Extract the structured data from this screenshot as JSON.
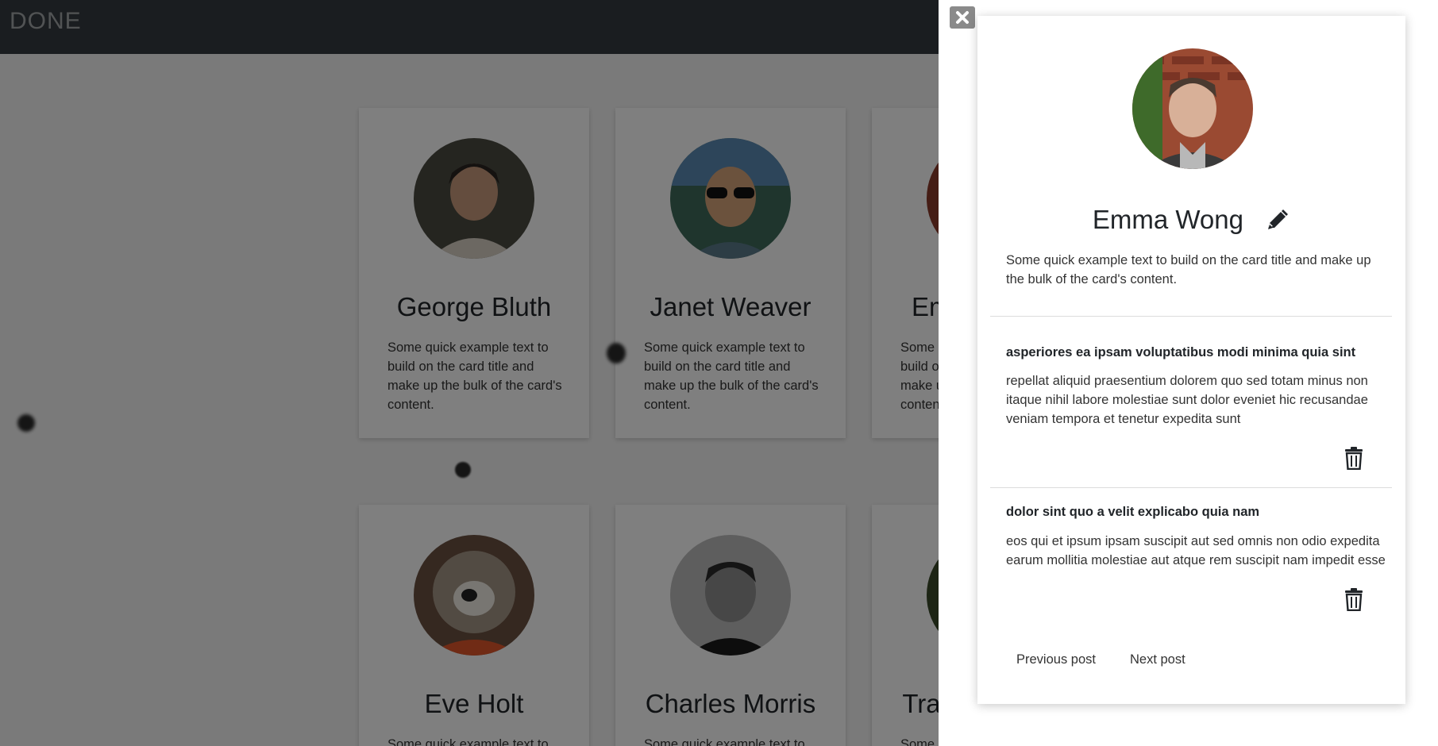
{
  "navbar": {
    "brand": "DONE"
  },
  "cards": [
    {
      "name": "George Bluth",
      "text": "Some quick example text to build on the card title and make up the bulk of the card's content."
    },
    {
      "name": "Janet Weaver",
      "text": "Some quick example text to build on the card title and make up the bulk of the card's content."
    },
    {
      "name": "Emma Wong",
      "text": "Some quick example text to build on the card title and make up the bulk of the card's content."
    },
    {
      "name": "Eve Holt",
      "text": "Some quick example text to"
    },
    {
      "name": "Charles Morris",
      "text": "Some quick example text to"
    },
    {
      "name": "Tracey Ramos",
      "text": "Some quick example text to"
    }
  ],
  "panel": {
    "name": "Emma Wong",
    "bio": "Some quick example text to build on the card title and make up the bulk of the card's content.",
    "posts": [
      {
        "title": "asperiores ea ipsam voluptatibus modi minima quia sint",
        "body": "repellat aliquid praesentium dolorem quo sed totam minus non itaque nihil labore molestiae sunt dolor eveniet hic recusandae veniam tempora et tenetur expedita sunt"
      },
      {
        "title": "dolor sint quo a velit explicabo quia nam",
        "body": "eos qui et ipsum ipsam suscipit aut sed omnis non odio expedita earum mollitia molestiae aut atque rem suscipit nam impedit esse"
      }
    ],
    "prev_label": "Previous post",
    "next_label": "Next post"
  },
  "icons": {
    "close": "close-icon",
    "edit": "pencil-icon",
    "delete": "trash-icon"
  },
  "colors": {
    "navbar": "#343a40",
    "overlay": "rgba(0,0,0,0.5)",
    "close_button": "#8a8a8a"
  }
}
